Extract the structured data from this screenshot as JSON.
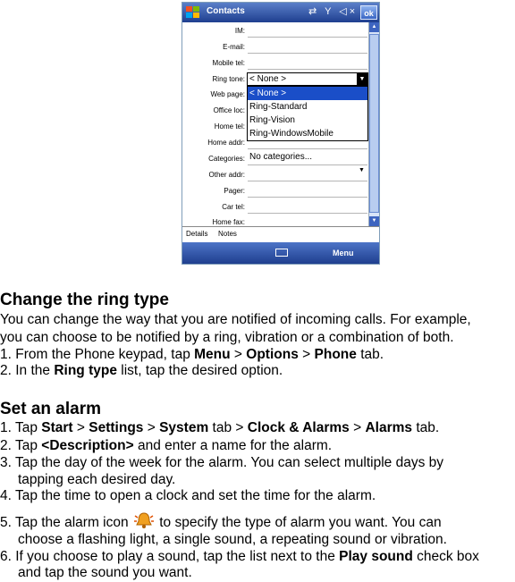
{
  "phone": {
    "app_title": "Contacts",
    "ok_label": "ok",
    "fields": [
      "IM:",
      "E-mail:",
      "Mobile tel:",
      "Ring tone:",
      "Web page:",
      "Office loc:",
      "Home tel:",
      "Home addr:",
      "Categories:",
      "Other addr:",
      "Pager:",
      "Car tel:",
      "Home fax:"
    ],
    "ring_tone_value": "< None >",
    "ring_options": [
      "< None >",
      "Ring-Standard",
      "Ring-Vision",
      "Ring-WindowsMobile"
    ],
    "categories_value": "No categories...",
    "tabs": [
      "Details",
      "Notes"
    ],
    "menu_label": "Menu"
  },
  "section1": {
    "heading": "Change the ring type",
    "intro1": "You can change the way that you are notified of incoming calls. For example,",
    "intro2": "you can choose to be notified by a ring, vibration or a combination of both.",
    "s1_a": "1. From the Phone keypad, tap ",
    "s1_menu": "Menu",
    "s1_gt1": " > ",
    "s1_options": "Options",
    "s1_gt2": " > ",
    "s1_phone": "Phone",
    "s1_end": " tab.",
    "s2_a": "2. In the ",
    "s2_ring": "Ring type",
    "s2_end": " list, tap the desired option."
  },
  "section2": {
    "heading": "Set an alarm",
    "s1_a": "1. Tap ",
    "s1_start": "Start",
    "s1_gt1": " > ",
    "s1_settings": "Settings",
    "s1_gt2": " > ",
    "s1_system": "System",
    "s1_tab": " tab > ",
    "s1_clock": "Clock & Alarms",
    "s1_gt3": " > ",
    "s1_alarms": "Alarms",
    "s1_end": " tab.",
    "s2_a": "2. Tap ",
    "s2_desc": "<Description>",
    "s2_end": " and enter a name for the alarm.",
    "s3_a": "3. Tap the day of the week for the alarm. You can select multiple days by",
    "s3_b": "tapping each desired day.",
    "s4": "4. Tap the time to open a clock and set the time for the alarm.",
    "s5_a": "5. Tap the alarm icon ",
    "s5_b": " to specify the type of alarm you want. You can",
    "s5_c": "choose a flashing light, a single sound, a repeating sound or vibration.",
    "s6_a": "6. If you choose to play a sound, tap the list next to the ",
    "s6_play": "Play sound",
    "s6_end": " check box",
    "s6_b": "and tap the sound you want."
  }
}
